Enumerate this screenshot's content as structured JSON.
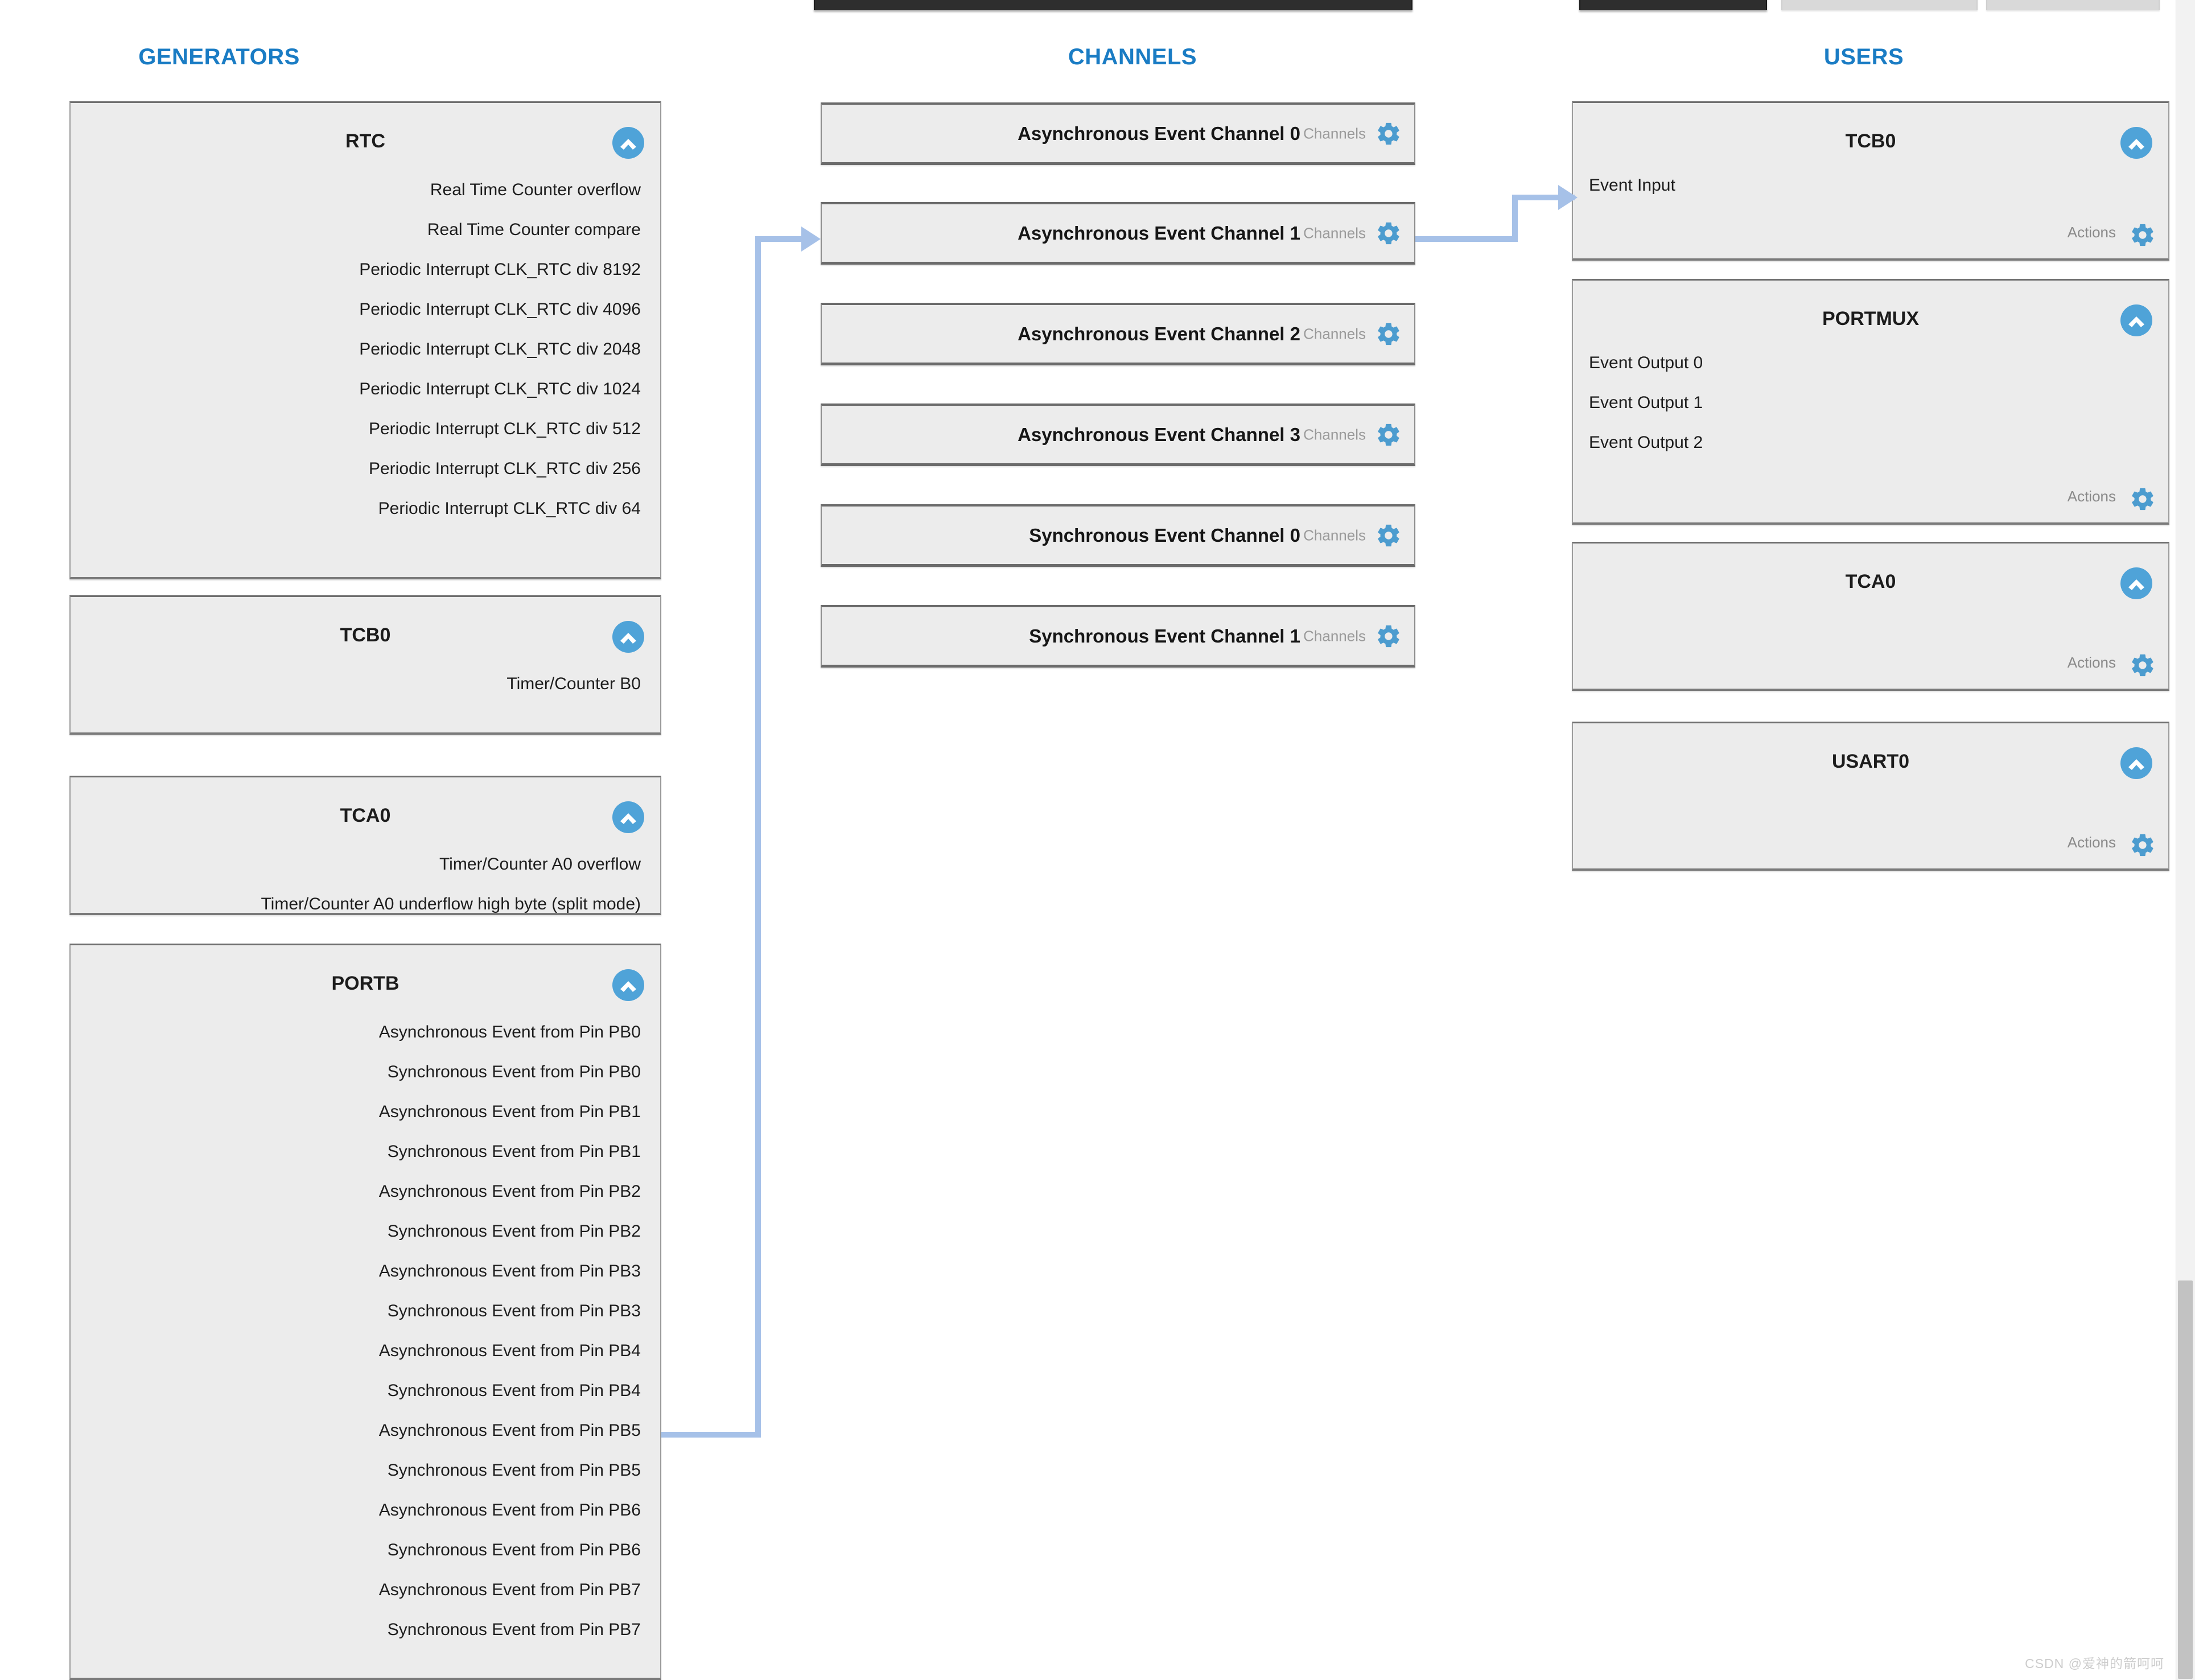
{
  "columns": {
    "generators_title": "GENERATORS",
    "channels_title": "CHANNELS",
    "users_title": "USERS"
  },
  "theme": {
    "accent_blue": "#1a7cc4",
    "icon_blue": "#4fa3d8",
    "panel_bg": "#ececec",
    "wire_blue": "#a6c1e8",
    "muted_text": "#9a9a9a"
  },
  "generators": [
    {
      "title": "RTC",
      "collapse_icon": "chevron-up-icon",
      "items": [
        "Real Time Counter overflow",
        "Real Time Counter compare",
        "Periodic Interrupt CLK_RTC div 8192",
        "Periodic Interrupt CLK_RTC div 4096",
        "Periodic Interrupt CLK_RTC div 2048",
        "Periodic Interrupt CLK_RTC div 1024",
        "Periodic Interrupt CLK_RTC div 512",
        "Periodic Interrupt CLK_RTC div 256",
        "Periodic Interrupt CLK_RTC div 64"
      ]
    },
    {
      "title": "TCB0",
      "collapse_icon": "chevron-up-icon",
      "items": [
        "Timer/Counter B0"
      ]
    },
    {
      "title": "TCA0",
      "collapse_icon": "chevron-up-icon",
      "items": [
        "Timer/Counter A0 overflow",
        "Timer/Counter A0 underflow high byte (split mode)"
      ]
    },
    {
      "title": "PORTB",
      "collapse_icon": "chevron-up-icon",
      "items": [
        "Asynchronous Event from Pin PB0",
        "Synchronous Event from Pin PB0",
        "Asynchronous Event from Pin PB1",
        "Synchronous Event from Pin PB1",
        "Asynchronous Event from Pin PB2",
        "Synchronous Event from Pin PB2",
        "Asynchronous Event from Pin PB3",
        "Synchronous Event from Pin PB3",
        "Asynchronous Event from Pin PB4",
        "Synchronous Event from Pin PB4",
        "Asynchronous Event from Pin PB5",
        "Synchronous Event from Pin PB5",
        "Asynchronous Event from Pin PB6",
        "Synchronous Event from Pin PB6",
        "Asynchronous Event from Pin PB7",
        "Synchronous Event from Pin PB7"
      ]
    }
  ],
  "channels": [
    {
      "name": "Asynchronous Event Channel 0",
      "sub": "Channels",
      "gear_icon": "gear-icon"
    },
    {
      "name": "Asynchronous Event Channel 1",
      "sub": "Channels",
      "gear_icon": "gear-icon"
    },
    {
      "name": "Asynchronous Event Channel 2",
      "sub": "Channels",
      "gear_icon": "gear-icon"
    },
    {
      "name": "Asynchronous Event Channel 3",
      "sub": "Channels",
      "gear_icon": "gear-icon"
    },
    {
      "name": "Synchronous Event Channel 0",
      "sub": "Channels",
      "gear_icon": "gear-icon"
    },
    {
      "name": "Synchronous Event Channel 1",
      "sub": "Channels",
      "gear_icon": "gear-icon"
    }
  ],
  "users": [
    {
      "title": "TCB0",
      "collapse_icon": "chevron-up-icon",
      "items": [
        "Event Input"
      ],
      "actions_label": "Actions",
      "gear_icon": "gear-icon"
    },
    {
      "title": "PORTMUX",
      "collapse_icon": "chevron-up-icon",
      "items": [
        "Event Output 0",
        "Event Output 1",
        "Event Output 2"
      ],
      "actions_label": "Actions",
      "gear_icon": "gear-icon"
    },
    {
      "title": "TCA0",
      "collapse_icon": "chevron-up-icon",
      "items": [],
      "actions_label": "Actions",
      "gear_icon": "gear-icon"
    },
    {
      "title": "USART0",
      "collapse_icon": "chevron-up-icon",
      "items": [],
      "actions_label": "Actions",
      "gear_icon": "gear-icon"
    }
  ],
  "connections": [
    {
      "from": "Asynchronous Event from Pin PB5",
      "to": "Asynchronous Event Channel 1"
    },
    {
      "from": "Asynchronous Event Channel 1",
      "to": "Event Input"
    }
  ],
  "watermark": "CSDN @爱神的箭呵呵"
}
